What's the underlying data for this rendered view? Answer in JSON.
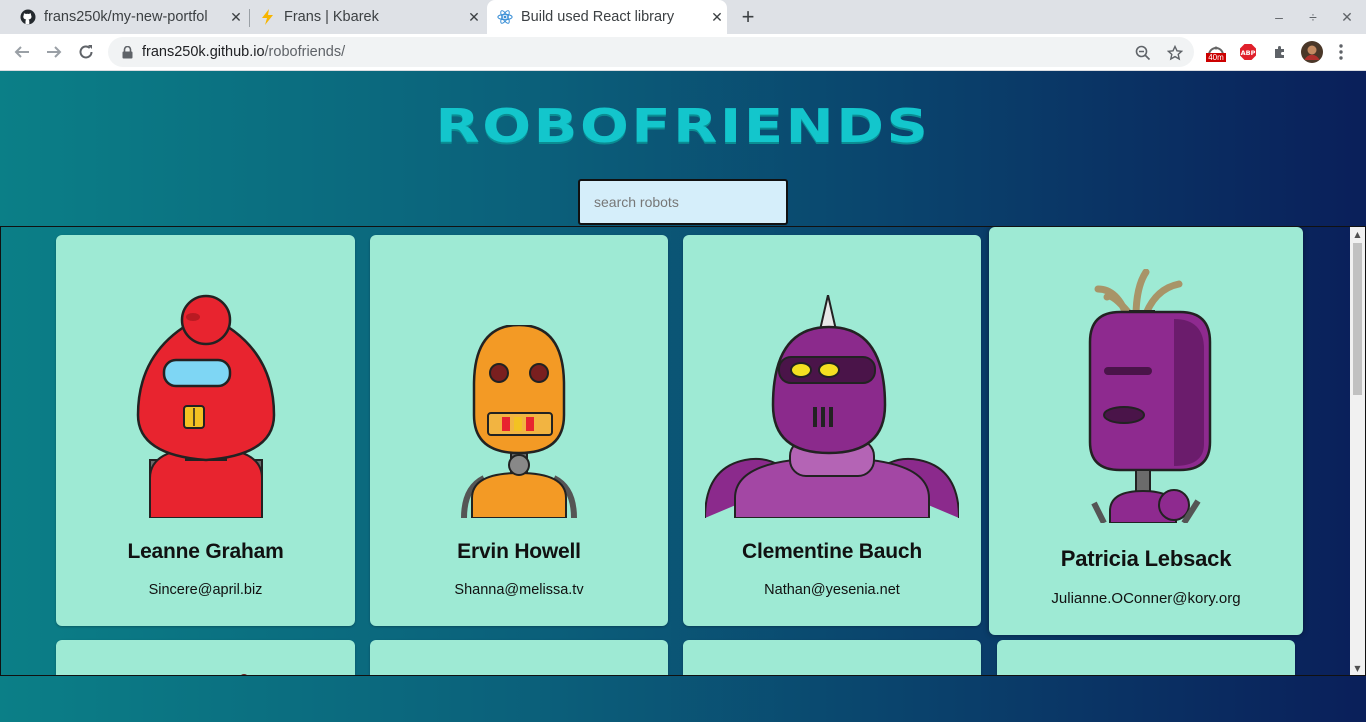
{
  "browser": {
    "tabs": [
      {
        "title": "frans250k/my-new-portfol",
        "favicon": "github-icon"
      },
      {
        "title": "Frans | Kbarek",
        "favicon": "lightning-icon"
      },
      {
        "title": "Build used React library",
        "favicon": "react-icon"
      }
    ],
    "active_tab": 2,
    "address": {
      "domain": "frans250k.github.io",
      "path": "/robofriends/"
    },
    "extension_badge": "40m"
  },
  "page": {
    "logo": "ROBOFRIENDS",
    "search": {
      "placeholder": "search robots",
      "value": ""
    }
  },
  "robots": [
    {
      "name": "Leanne Graham",
      "email": "Sincere@april.biz",
      "color": "#e8242f"
    },
    {
      "name": "Ervin Howell",
      "email": "Shanna@melissa.tv",
      "color": "#f39a25"
    },
    {
      "name": "Clementine Bauch",
      "email": "Nathan@yesenia.net",
      "color": "#8b2a8c"
    },
    {
      "name": "Patricia Lebsack",
      "email": "Julianne.OConner@kory.org",
      "color": "#8e2a8f"
    }
  ],
  "colors": {
    "card": "#9eead4",
    "accent": "#13c6cc"
  }
}
